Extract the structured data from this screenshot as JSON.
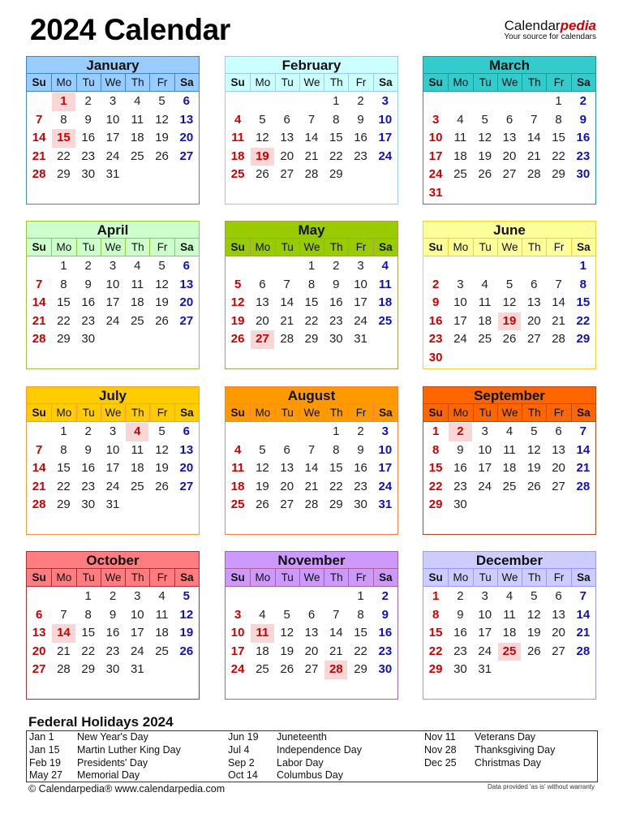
{
  "header": {
    "title": "2024 Calendar",
    "brand_main": "Calendar",
    "brand_accent": "pedia",
    "brand_tagline": "Your source for calendars"
  },
  "weekdays": [
    "Su",
    "Mo",
    "Tu",
    "We",
    "Th",
    "Fr",
    "Sa"
  ],
  "colors": {
    "sunday": "#cc0000",
    "saturday": "#1010c0",
    "holiday_bg": "#fbd6d6"
  },
  "months": [
    {
      "name": "January",
      "offset": 1,
      "days": 31,
      "holidays": [
        1,
        15
      ],
      "head_bg": "#99ccff",
      "border": "#3d85d6"
    },
    {
      "name": "February",
      "offset": 4,
      "days": 29,
      "holidays": [
        19
      ],
      "head_bg": "#ccffff",
      "border": "#99ccff"
    },
    {
      "name": "March",
      "offset": 5,
      "days": 31,
      "holidays": [],
      "head_bg": "#33cccc",
      "border": "#1e9a9a"
    },
    {
      "name": "April",
      "offset": 1,
      "days": 30,
      "holidays": [],
      "head_bg": "#ccffcc",
      "border": "#99cc33"
    },
    {
      "name": "May",
      "offset": 3,
      "days": 31,
      "holidays": [
        27
      ],
      "head_bg": "#99cc00",
      "border": "#a8a050"
    },
    {
      "name": "June",
      "offset": 6,
      "days": 30,
      "holidays": [
        19
      ],
      "head_bg": "#ffff99",
      "border": "#ffcc33"
    },
    {
      "name": "July",
      "offset": 1,
      "days": 31,
      "holidays": [
        4
      ],
      "head_bg": "#ffcc00",
      "border": "#ff9933"
    },
    {
      "name": "August",
      "offset": 4,
      "days": 31,
      "holidays": [],
      "head_bg": "#ff9900",
      "border": "#ff8040"
    },
    {
      "name": "September",
      "offset": 0,
      "days": 30,
      "holidays": [
        2
      ],
      "head_bg": "#ff6600",
      "border": "#b84a1a"
    },
    {
      "name": "October",
      "offset": 2,
      "days": 31,
      "holidays": [
        14
      ],
      "head_bg": "#ff7c80",
      "border": "#a83030"
    },
    {
      "name": "November",
      "offset": 5,
      "days": 30,
      "holidays": [
        11,
        28
      ],
      "head_bg": "#cc99ff",
      "border": "#b06090"
    },
    {
      "name": "December",
      "offset": 0,
      "days": 31,
      "holidays": [
        25
      ],
      "head_bg": "#ccccff",
      "border": "#9999ff"
    }
  ],
  "federal_holidays": {
    "title": "Federal Holidays 2024",
    "columns": [
      [
        {
          "date": "Jan 1",
          "name": "New Year's Day"
        },
        {
          "date": "Jan 15",
          "name": "Martin Luther King Day"
        },
        {
          "date": "Feb 19",
          "name": "Presidents' Day"
        },
        {
          "date": "May 27",
          "name": "Memorial Day"
        }
      ],
      [
        {
          "date": "Jun 19",
          "name": "Juneteenth"
        },
        {
          "date": "Jul 4",
          "name": "Independence Day"
        },
        {
          "date": "Sep 2",
          "name": "Labor Day"
        },
        {
          "date": "Oct 14",
          "name": "Columbus Day"
        }
      ],
      [
        {
          "date": "Nov 11",
          "name": "Veterans Day"
        },
        {
          "date": "Nov 28",
          "name": "Thanksgiving Day"
        },
        {
          "date": "Dec 25",
          "name": "Christmas Day"
        }
      ]
    ]
  },
  "footer": {
    "copyright": "© Calendarpedia®   www.calendarpedia.com",
    "disclaimer": "Data provided 'as is' without warranty"
  }
}
